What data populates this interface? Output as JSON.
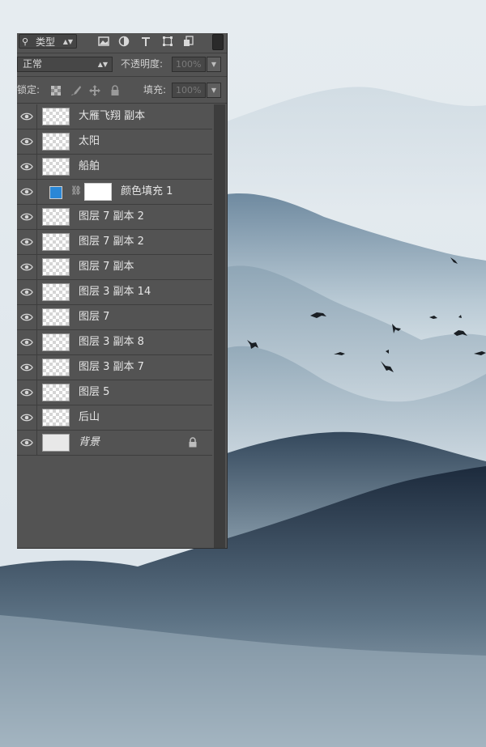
{
  "toolbar": {
    "kind_label": "类型",
    "filter_icons": [
      "image-filter-icon",
      "adjustment-filter-icon",
      "type-filter-icon",
      "shape-filter-icon",
      "smart-object-filter-icon"
    ]
  },
  "blend": {
    "mode": "正常",
    "opacity_label": "不透明度:",
    "opacity_value": "100%"
  },
  "locks": {
    "label": "锁定:",
    "fill_label": "填充:",
    "fill_value": "100%"
  },
  "layers": [
    {
      "name": "大雁飞翔 副本",
      "thumb": "checker"
    },
    {
      "name": "太阳",
      "thumb": "checker"
    },
    {
      "name": "船舶",
      "thumb": "checker"
    },
    {
      "name": "颜色填充 1",
      "thumb": "fill",
      "fill_color": "#2a87d6"
    },
    {
      "name": "图层 7 副本 2",
      "thumb": "checker"
    },
    {
      "name": "图层 7 副本 2",
      "thumb": "checker"
    },
    {
      "name": "图层 7 副本",
      "thumb": "checker"
    },
    {
      "name": "图层 3 副本 14",
      "thumb": "checker"
    },
    {
      "name": "图层 7",
      "thumb": "checker"
    },
    {
      "name": "图层 3 副本 8",
      "thumb": "checker"
    },
    {
      "name": "图层 3 副本 7",
      "thumb": "checker"
    },
    {
      "name": "图层 5",
      "thumb": "checker"
    },
    {
      "name": "后山",
      "thumb": "checker"
    },
    {
      "name": "背景",
      "thumb": "plain",
      "locked": true
    }
  ]
}
